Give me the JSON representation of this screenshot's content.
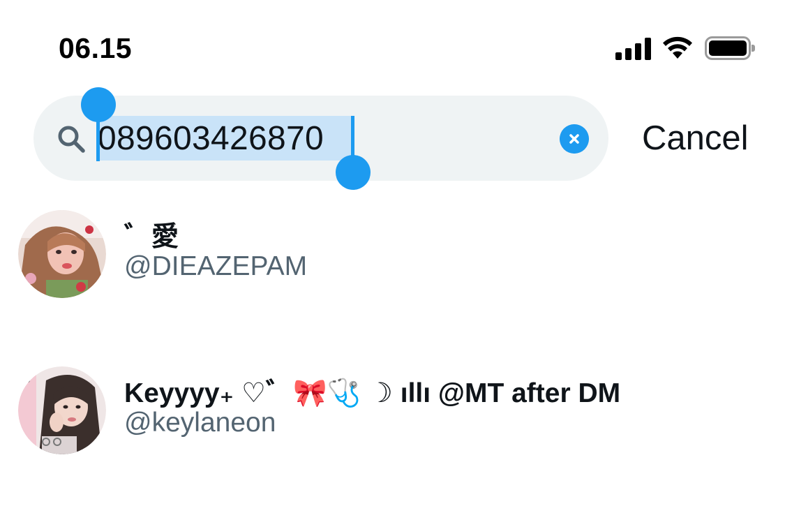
{
  "status_bar": {
    "time": "06.15",
    "icons": [
      "cellular-signal-icon",
      "wifi-icon",
      "battery-icon"
    ]
  },
  "search": {
    "query": "089603426870",
    "cancel_label": "Cancel",
    "accent_color": "#1d9bf0",
    "field_background": "#eff3f4",
    "icons": [
      "search-icon",
      "clear-icon"
    ]
  },
  "results": [
    {
      "name": "゛愛",
      "handle": "@DIEAZEPAM"
    },
    {
      "name": "Keyyyy₊ ♡゛🎀🩺 ☽ ıllı @MT after DM",
      "handle": "@keylaneon"
    }
  ]
}
